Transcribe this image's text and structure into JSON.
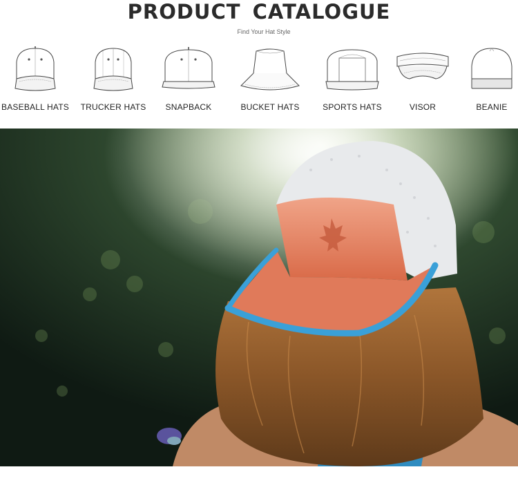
{
  "header": {
    "title": "PRODUCT  CATALOGUE",
    "subtitle": "Find Your Hat Style"
  },
  "hat_styles": [
    {
      "label": "BASEBALL HATS",
      "icon": "baseball-hat-icon"
    },
    {
      "label": "TRUCKER HATS",
      "icon": "trucker-hat-icon"
    },
    {
      "label": "SNAPBACK",
      "icon": "snapback-hat-icon"
    },
    {
      "label": "BUCKET HATS",
      "icon": "bucket-hat-icon"
    },
    {
      "label": "SPORTS HATS",
      "icon": "sports-hat-icon"
    },
    {
      "label": "VISOR",
      "icon": "visor-icon"
    },
    {
      "label": "BEANIE",
      "icon": "beanie-icon"
    }
  ],
  "colors": {
    "cap_front": "#e07a5a",
    "cap_brim_edge": "#3aa0d8",
    "cap_mesh": "#e8eaec",
    "top_bg": "#1b2a20",
    "tank_top": "#2f8cc0"
  }
}
